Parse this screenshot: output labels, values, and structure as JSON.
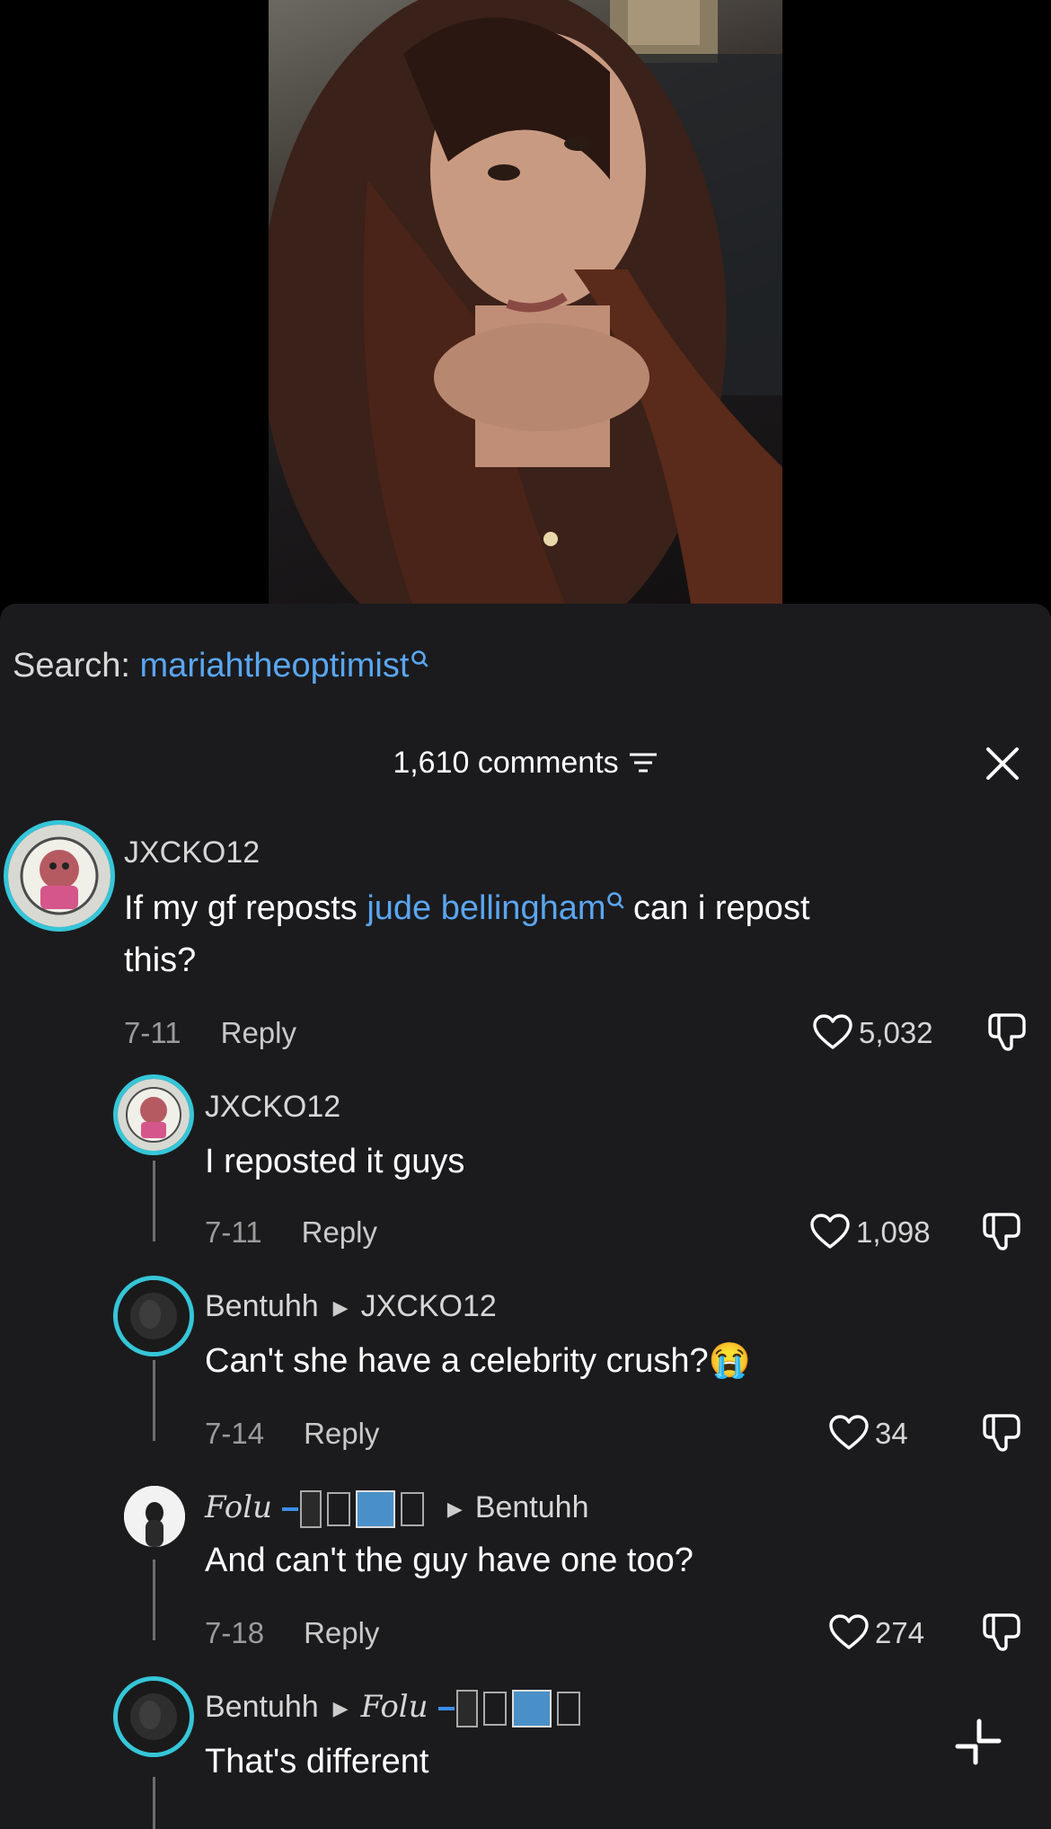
{
  "search": {
    "label": "Search:",
    "term": "mariahtheoptimist"
  },
  "header": {
    "count_label": "1,610 comments"
  },
  "colors": {
    "accent": "#5aa6f2",
    "ring": "#35c6d8",
    "sheet": "#1b1b1d"
  },
  "comments": [
    {
      "username": "JXCKO12",
      "text_before": "If my gf reposts ",
      "link": "jude bellingham",
      "text_after": " can i repost",
      "text_line2": "this?",
      "date": "7-11",
      "reply_label": "Reply",
      "likes": "5,032"
    },
    {
      "username": "JXCKO12",
      "text": "I reposted it guys",
      "date": "7-11",
      "reply_label": "Reply",
      "likes": "1,098"
    },
    {
      "username": "Bentuhh",
      "reply_to": "JXCKO12",
      "text": "Can't she have a celebrity crush?😭",
      "date": "7-14",
      "reply_label": "Reply",
      "likes": "34"
    },
    {
      "username": "Folu",
      "reply_to": "Bentuhh",
      "text": "And can't the guy have one too?",
      "date": "7-18",
      "reply_label": "Reply",
      "likes": "274"
    },
    {
      "username": "Bentuhh",
      "reply_to": "Folu",
      "text": "That's different",
      "date": "",
      "reply_label": "",
      "likes": ""
    }
  ],
  "icons": [
    "search-icon",
    "filter-icon",
    "close-icon",
    "heart-icon",
    "dislike-icon",
    "collapse-icon"
  ]
}
